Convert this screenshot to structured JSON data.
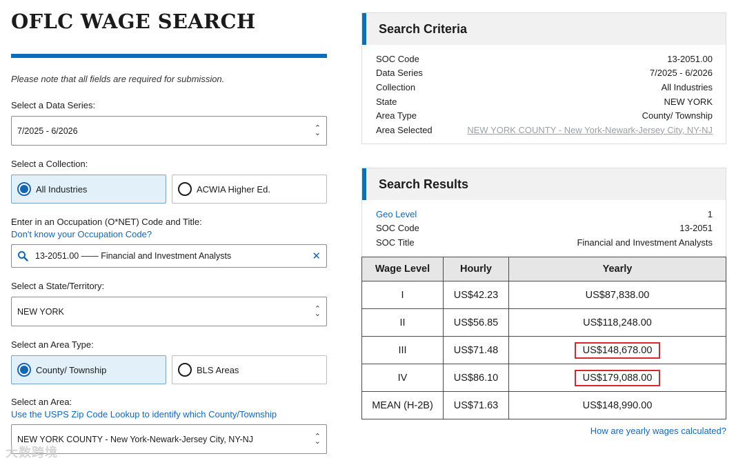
{
  "form": {
    "title": "OFLC WAGE SEARCH",
    "note": "Please note that all fields are required for submission.",
    "data_series": {
      "label": "Select a Data Series:",
      "value": "7/2025 - 6/2026"
    },
    "collection": {
      "label": "Select a Collection:",
      "options": [
        "All Industries",
        "ACWIA Higher Ed."
      ],
      "selected": "All Industries"
    },
    "occupation": {
      "label": "Enter in an Occupation (O*NET) Code and Title:",
      "help_link": "Don't know your Occupation Code?",
      "value": "13-2051.00 —— Financial and Investment Analysts"
    },
    "state": {
      "label": "Select a State/Territory:",
      "value": "NEW YORK"
    },
    "area_type": {
      "label": "Select an Area Type:",
      "options": [
        "County/ Township",
        "BLS Areas"
      ],
      "selected": "County/ Township"
    },
    "area": {
      "label": "Select an Area:",
      "help_link": "Use the USPS Zip Code Lookup to identify which County/Township",
      "value": "NEW YORK COUNTY - New York-Newark-Jersey City, NY-NJ"
    }
  },
  "criteria": {
    "title": "Search Criteria",
    "rows": [
      {
        "k": "SOC Code",
        "v": "13-2051.00"
      },
      {
        "k": "Data Series",
        "v": "7/2025 - 6/2026"
      },
      {
        "k": "Collection",
        "v": "All Industries"
      },
      {
        "k": "State",
        "v": "NEW YORK"
      },
      {
        "k": "Area Type",
        "v": "County/ Township"
      },
      {
        "k": "Area Selected",
        "v": "NEW YORK COUNTY - New York-Newark-Jersey City, NY-NJ"
      }
    ]
  },
  "results": {
    "title": "Search Results",
    "rows": [
      {
        "k": "Geo Level",
        "v": "1"
      },
      {
        "k": "SOC Code",
        "v": "13-2051"
      },
      {
        "k": "SOC Title",
        "v": "Financial and Investment Analysts"
      }
    ],
    "table": {
      "headers": [
        "Wage Level",
        "Hourly",
        "Yearly"
      ],
      "rows": [
        [
          "I",
          "US$42.23",
          "US$87,838.00"
        ],
        [
          "II",
          "US$56.85",
          "US$118,248.00"
        ],
        [
          "III",
          "US$71.48",
          "US$148,678.00"
        ],
        [
          "IV",
          "US$86.10",
          "US$179,088.00"
        ],
        [
          "MEAN (H-2B)",
          "US$71.63",
          "US$148,990.00"
        ]
      ]
    },
    "yearly_link": "How are yearly wages calculated?"
  },
  "watermark": "大数跨境",
  "colors": {
    "accent": "#0a6fb8",
    "link": "#1565b5",
    "highlight": "#d8262b"
  }
}
